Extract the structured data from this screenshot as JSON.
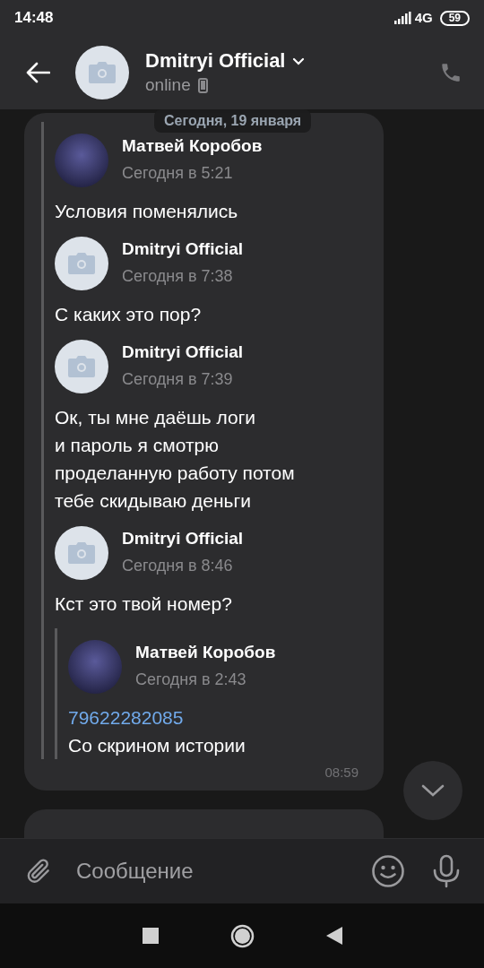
{
  "status_bar": {
    "time": "14:48",
    "network": "4G",
    "battery": "59"
  },
  "header": {
    "title": "Dmitryi Official",
    "status": "online"
  },
  "date_badge": "Сегодня, 19 января",
  "messages": [
    {
      "kind": "forward",
      "time": "08:59",
      "forwarded": [
        {
          "author": "Матвей Коробов",
          "photo": true,
          "time": "Сегодня в 5:21",
          "text": "Условия поменялись"
        },
        {
          "author": "Dmitryi Official",
          "photo": false,
          "time": "Сегодня в 7:38",
          "text": "С каких это пор?"
        },
        {
          "author": "Dmitryi Official",
          "photo": false,
          "time": "Сегодня в 7:39",
          "text": "Ок, ты мне даёшь логи\nи пароль я смотрю\nпроделанную работу потом\nтебе скидываю деньги"
        },
        {
          "author": "Dmitryi Official",
          "photo": false,
          "time": "Сегодня в 8:46",
          "text": "Кст это твой номер?",
          "forwarded": [
            {
              "author": "Матвей Коробов",
              "photo": true,
              "time": "Сегодня в 2:43",
              "link": "79622282085",
              "text": "Со скрином истории"
            }
          ]
        }
      ]
    },
    {
      "kind": "text"
    }
  ],
  "composer": {
    "placeholder": "Сообщение"
  }
}
